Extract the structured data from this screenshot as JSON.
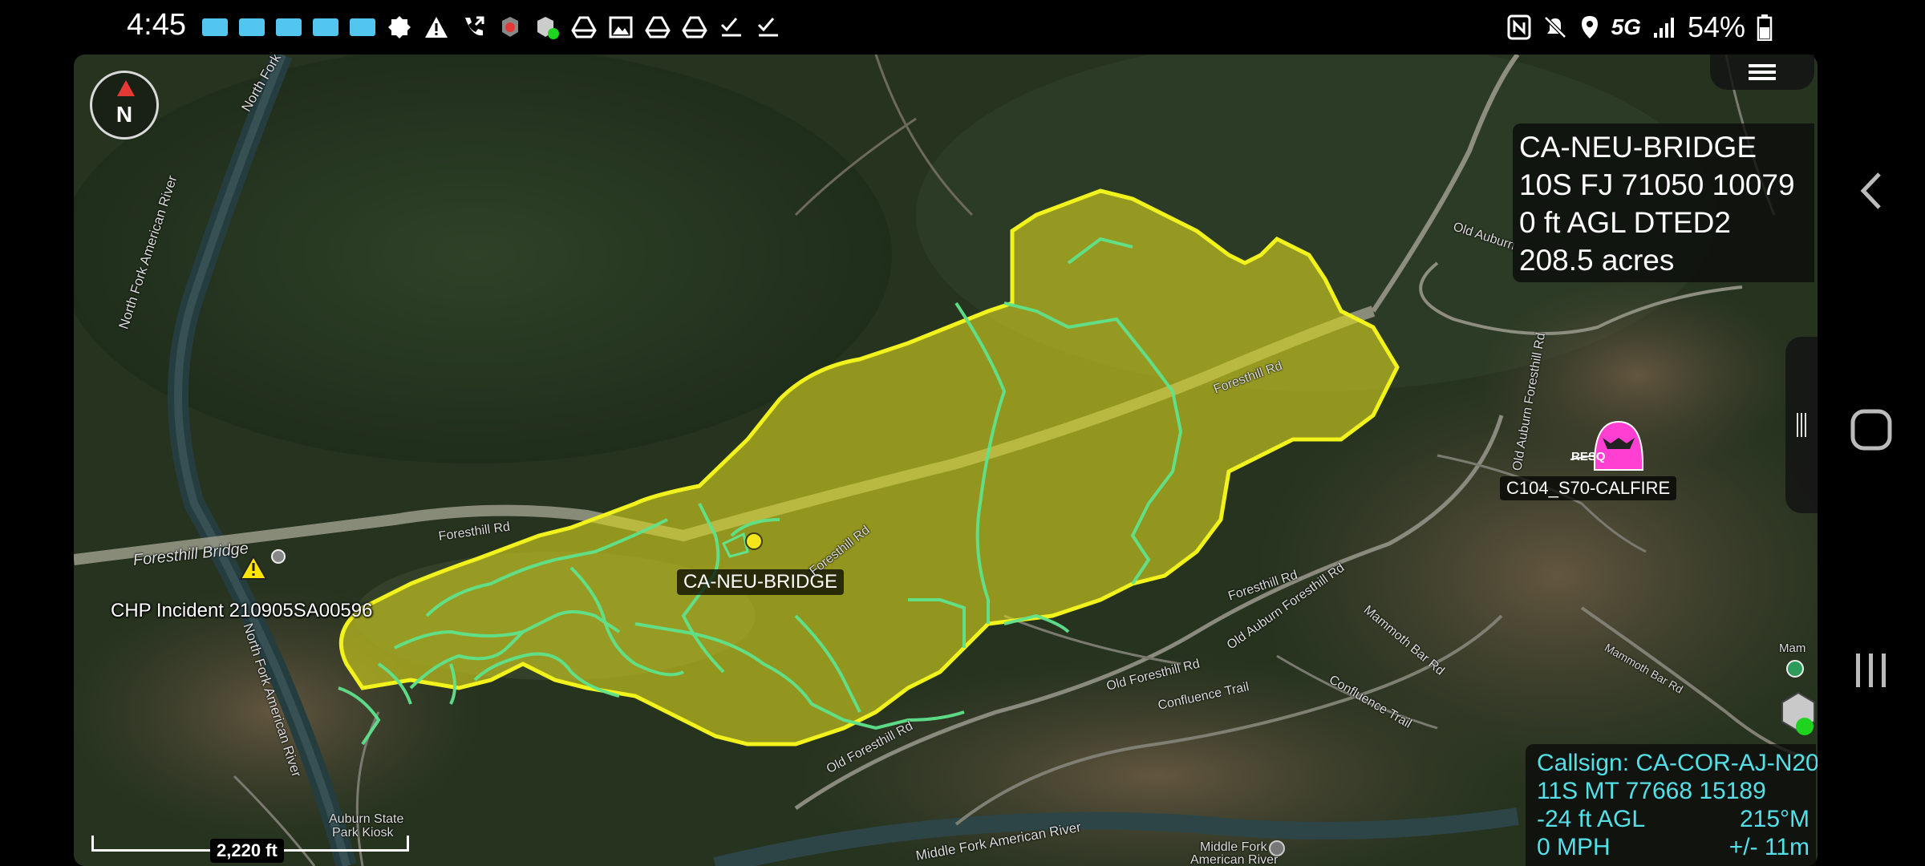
{
  "status_bar": {
    "time": "4:45",
    "left_icons": [
      "app-rect-icon",
      "app-rect-icon",
      "app-rect-icon",
      "app-rect-icon",
      "app-rect-icon",
      "badge-icon",
      "warning-icon",
      "call-forward-icon",
      "tak-red-icon",
      "tak-green-icon",
      "drive-icon",
      "image-icon",
      "drive-icon",
      "drive-icon",
      "checklist-icon",
      "checklist-icon"
    ],
    "right_icons": [
      "nfc-icon",
      "mute-icon",
      "location-icon"
    ],
    "network": "5G",
    "battery": "54%"
  },
  "map": {
    "compass_label": "N",
    "selected_item_panel": {
      "name": "CA-NEU-BRIDGE",
      "mgrs": "10S FJ 71050 10079",
      "elevation": "0 ft AGL DTED2",
      "area": "208.5 acres"
    },
    "self_panel": {
      "callsign": "Callsign: CA-COR-AJ-N20",
      "mgrs": "11S  MT  77668  15189",
      "elevation": "-24 ft AGL",
      "heading": "215°M",
      "speed": "0 MPH",
      "accuracy": "+/- 11m"
    },
    "scale_label": "2,220 ft",
    "markers": {
      "fire_label": "CA-NEU-BRIDGE",
      "incident_label": "CHP Incident 210905SA00596",
      "resource_label": "C104_S70-CALFIRE",
      "resource_badge": "RESQ"
    },
    "place_labels": {
      "north_fork_1": "North Fork American River",
      "north_fork_2": "North Fork American River",
      "north_fork_top": "North Fork",
      "foresthill_bridge": "Foresthill Bridge",
      "auburn_park_1": "Auburn State",
      "auburn_park_2": "Park Kiosk",
      "middle_fork": "Middle Fork American River",
      "middle_fork_poi_1": "Middle Fork",
      "middle_fork_poi_2": "American River",
      "mam": "Mam"
    },
    "road_labels": {
      "foresthill_rd_1": "Foresthill Rd",
      "foresthill_rd_2": "Foresthill Rd",
      "foresthill_rd_3": "Foresthill Rd",
      "foresthill_rd_4": "Foresthill Rd",
      "old_auburn_1": "Old Auburn",
      "old_auburn_foresthill_1": "Old Auburn Foresthill Rd",
      "old_auburn_foresthill_2": "Old Auburn Foresthill Rd",
      "old_foresthill_1": "Old Foresthill Rd",
      "old_foresthill_2": "Old Foresthill Rd",
      "confluence_trail_1": "Confluence Trail",
      "confluence_trail_2": "Confluence Trail",
      "mammoth_bar_1": "Mammoth Bar Rd",
      "mammoth_bar_2": "Mammoth Bar Rd"
    }
  },
  "colors": {
    "fire_fill": "#d7d41f",
    "fire_stroke": "#f2f21c",
    "line_green": "#5fe38c",
    "info_text": "#ffffff",
    "self_text": "#53e0e8",
    "resource_pink": "#ff3fd2"
  }
}
